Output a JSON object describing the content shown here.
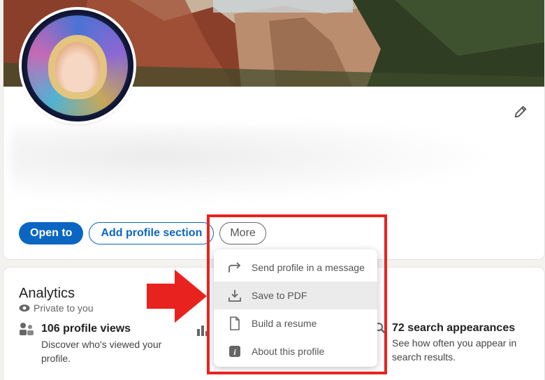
{
  "profile": {
    "more_buttons": {
      "open_to": "Open to",
      "add_section": "Add profile section",
      "more": "More"
    },
    "icons": {
      "edit": "pencil-icon"
    }
  },
  "analytics": {
    "title": "Analytics",
    "privacy": "Private to you",
    "stats": [
      {
        "head": "106 profile views",
        "sub1": "Discover who's viewed your",
        "sub2": "profile.",
        "icon": "people-icon"
      },
      {
        "head": "72 search appearances",
        "sub1": "See how often you appear in",
        "sub2": "search results.",
        "icon": "search-icon"
      }
    ]
  },
  "more_menu": {
    "items": [
      {
        "label": "Send profile in a message",
        "icon": "share-arrow-icon"
      },
      {
        "label": "Save to PDF",
        "icon": "download-icon"
      },
      {
        "label": "Build a resume",
        "icon": "document-icon"
      },
      {
        "label": "About this profile",
        "icon": "info-icon"
      }
    ],
    "highlighted_index": 1
  },
  "colors": {
    "brand_blue": "#0a66c2",
    "annotation_red": "#e8231f"
  }
}
